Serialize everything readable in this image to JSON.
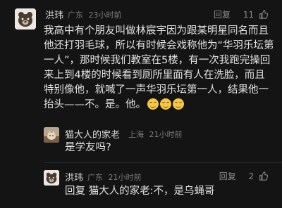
{
  "comments": [
    {
      "user": "洪玮",
      "location": "广东",
      "time": "23小时前",
      "reply_label": "回复",
      "likes": "11",
      "lines": [
        "我高中有个朋友叫做林宸宇因为跟某明星同名而且",
        "他还打羽毛球，所以有时候会戏称他为“华羽乐坛第",
        "一人”，那时候我们教室在5楼，有一次我跑完操回",
        "来上到4楼的时候看到厕所里面有人在洗脸，而且",
        "特别像他，就喊了一声华羽乐坛第一人，结果他一",
        "抬头——不。是。他。"
      ],
      "emoji": [
        "grinning-face-emoji",
        "grinning-face-emoji",
        "grinning-face-emoji"
      ]
    },
    {
      "user": "猫大人的家老",
      "location": "上海",
      "time": "21小时前",
      "text": "是学友吗?"
    },
    {
      "user": "洪玮",
      "location": "广东",
      "time": "21小时前",
      "reply_label": "回复",
      "likes": "2",
      "reply_prefix": "回复 猫大人的家老:",
      "text": "不，是乌蝇哥"
    }
  ],
  "colors": {
    "background": "#141414",
    "text": "#e2e2e2",
    "meta": "#7a7a7a",
    "emoji": "#f6c744"
  }
}
